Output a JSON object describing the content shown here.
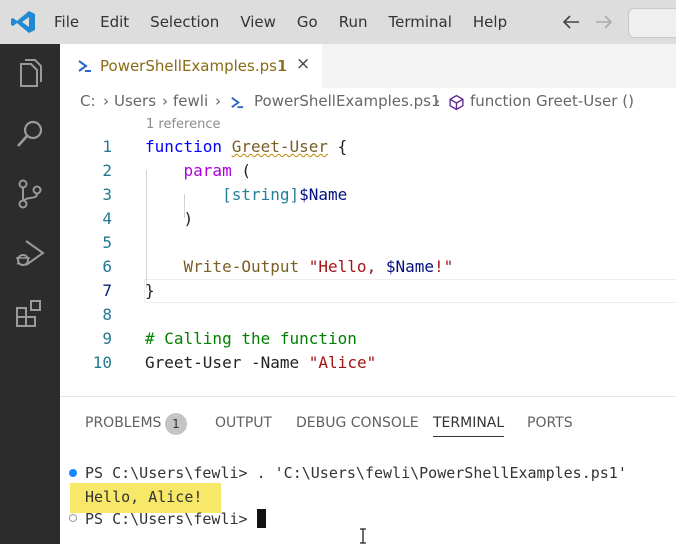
{
  "menu": {
    "items": [
      "File",
      "Edit",
      "Selection",
      "View",
      "Go",
      "Run",
      "Terminal",
      "Help"
    ],
    "back_icon": "arrow-left-icon",
    "forward_icon": "arrow-right-icon"
  },
  "activity_bar": {
    "icons": [
      "explorer-icon",
      "search-icon",
      "source-control-icon",
      "run-debug-icon",
      "extensions-icon"
    ]
  },
  "editor_tab": {
    "file_name": "PowerShellExamples.ps1",
    "problem_count": "1",
    "close_glyph": "×"
  },
  "breadcrumb": {
    "drive": "C:",
    "sep": "›",
    "folder1": "Users",
    "folder2": "fewli",
    "file": "PowerShellExamples.ps1",
    "symbol": "function Greet-User ()"
  },
  "codelens": "1 reference",
  "code": {
    "line_numbers": [
      "1",
      "2",
      "3",
      "4",
      "5",
      "6",
      "7",
      "8",
      "9",
      "10"
    ],
    "l1_kw": "function",
    "l1_name": "Greet-User",
    "l1_brace": "{",
    "l2_param": "param",
    "l2_paren": "(",
    "l3_type": "[string]",
    "l3_var": "$Name",
    "l4": ")",
    "l6_cmd": "Write-Output",
    "l6_str_open": "\"Hello, ",
    "l6_var": "$Name",
    "l6_str_close": "!\"",
    "l7": "}",
    "l9_comment": "# Calling the function",
    "l10_cmd": "Greet-User",
    "l10_param": "-Name",
    "l10_str": "\"Alice\""
  },
  "panel": {
    "tabs": [
      "PROBLEMS",
      "OUTPUT",
      "DEBUG CONSOLE",
      "TERMINAL",
      "PORTS"
    ],
    "problems_badge": "1",
    "active_tab": "TERMINAL"
  },
  "terminal": {
    "prompt": "PS C:\\Users\\fewli>",
    "command": ". 'C:\\Users\\fewli\\PowerShellExamples.ps1'",
    "output": "Hello, Alice!",
    "prompt2": "PS C:\\Users\\fewli>"
  },
  "colors": {
    "accent": "#0078d4",
    "activity_bar": "#2c2c2c",
    "highlight": "#f7e86a"
  }
}
